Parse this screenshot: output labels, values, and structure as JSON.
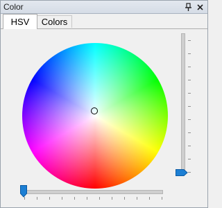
{
  "window": {
    "title": "Color",
    "pin_icon": "pin-icon",
    "close_icon": "close-icon"
  },
  "tabs": [
    {
      "label": "HSV",
      "selected": true
    },
    {
      "label": "Colors",
      "selected": false
    }
  ],
  "color_wheel": {
    "hue_order": [
      "cyan",
      "green",
      "yellow",
      "red",
      "magenta",
      "blue"
    ],
    "selected_saturation": 0,
    "selected_hue_deg": 0
  },
  "sliders": {
    "vertical": {
      "value_fraction": 0.0,
      "tick_count": 11,
      "thumb_color": "#1c7fd4"
    },
    "horizontal": {
      "value_fraction": 0.0,
      "tick_count": 12,
      "thumb_color": "#1c7fd4"
    }
  },
  "colors": {
    "accent": "#1c7fd4",
    "tab_active_bg": "#ffffff",
    "panel_bg": "#f0f0f0"
  }
}
